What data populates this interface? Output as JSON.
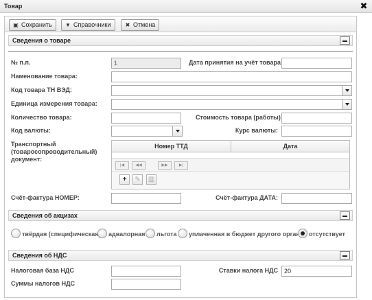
{
  "window": {
    "title": "Товар",
    "close_icon": "✖"
  },
  "toolbar": {
    "save_label": "Сохранить",
    "directories_label": "Справочники",
    "cancel_label": "Отмена"
  },
  "sections": {
    "goods": "Сведения о товаре",
    "excise": "Сведения об акцизах",
    "vat": "Сведения об НДС"
  },
  "form": {
    "row_number_label": "№ п.п.",
    "row_number_value": "1",
    "accounting_date_label": "Дата принятия на учёт товара:",
    "accounting_date_value": "",
    "goods_name_label": "Наменование товара:",
    "goods_name_value": "",
    "tnved_code_label": "Код товара ТН ВЭД:",
    "tnved_code_value": "",
    "unit_label": "Единица измерения товара:",
    "unit_value": "",
    "quantity_label": "Количество товара:",
    "quantity_value": "",
    "cost_label": "Стоимость товара (работы):",
    "cost_value": "",
    "currency_code_label": "Код валюты:",
    "currency_code_value": "",
    "exchange_rate_label": "Курс валюты:",
    "exchange_rate_value": "",
    "transport_doc_label": "Транспортный (товаросопроводительный) документ:",
    "invoice_number_label": "Счёт-фактура НОМЕР:",
    "invoice_number_value": "",
    "invoice_date_label": "Счёт-фактура ДАТА:",
    "invoice_date_value": ""
  },
  "ttd_grid": {
    "columns": [
      "Номер ТТД",
      "Дата"
    ],
    "rows": [],
    "pager_icons": [
      "first-page-icon",
      "prev-page-icon",
      "next-page-icon",
      "last-page-icon"
    ],
    "action_icons": [
      "add-icon",
      "edit-icon",
      "delete-icon"
    ]
  },
  "excise": {
    "options": [
      "твёрдая (специфическая)",
      "адвалорная",
      "льгота",
      "уплаченная в бюджет другого органа",
      "отсутствует"
    ],
    "selected": "отсутствует"
  },
  "vat": {
    "tax_base_label": "Налоговая база НДС",
    "tax_base_value": "",
    "tax_rate_label": "Ставки налога НДС",
    "tax_rate_value": "20",
    "tax_sum_label": "Суммы налогов НДС",
    "tax_sum_value": ""
  }
}
